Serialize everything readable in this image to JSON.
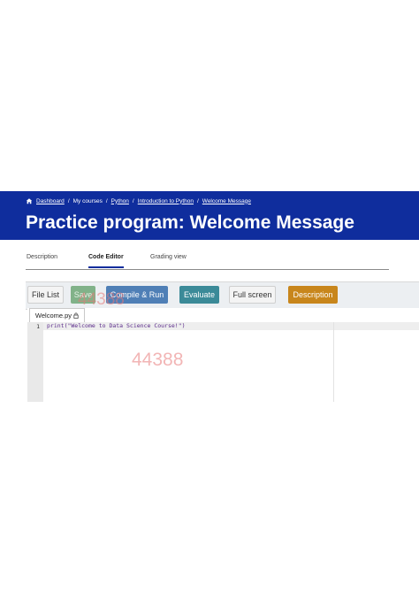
{
  "breadcrumb": {
    "items": [
      {
        "label": "Dashboard",
        "link": true
      },
      {
        "label": "My courses",
        "link": false
      },
      {
        "label": "Python",
        "link": true
      },
      {
        "label": "Introduction to Python",
        "link": true
      },
      {
        "label": "Welcome Message",
        "link": true
      }
    ],
    "separator": "/",
    "icon": "home-icon"
  },
  "page_title": "Practice program: Welcome Message",
  "tabs": [
    {
      "label": "Description",
      "active": false
    },
    {
      "label": "Code Editor",
      "active": true
    },
    {
      "label": "Grading view",
      "active": false
    }
  ],
  "toolbar": {
    "file_list": "File List",
    "save": "Save",
    "compile_run": "Compile & Run",
    "evaluate": "Evaluate",
    "full_screen": "Full screen",
    "description": "Description"
  },
  "watermarks": [
    "44388",
    "44388"
  ],
  "editor": {
    "file_tab": "Welcome.py",
    "file_tab_icon": "lock-icon",
    "line_number": "1",
    "code": "print(\"Welcome to Data Science Course!\")"
  },
  "colors": {
    "header": "#0f2d9d",
    "save": "#6fa877",
    "compile": "#4f7fb6",
    "evaluate": "#3b8a98",
    "description": "#c8861c"
  }
}
